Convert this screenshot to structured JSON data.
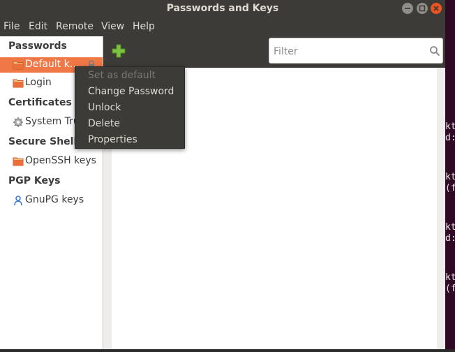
{
  "window": {
    "title": "Passwords and Keys"
  },
  "menubar": [
    "File",
    "Edit",
    "Remote",
    "View",
    "Help"
  ],
  "sidebar": {
    "sections": [
      {
        "title": "Passwords",
        "items": [
          {
            "label": "Default k…",
            "icon": "folder-icon",
            "locked": true,
            "selected": true
          },
          {
            "label": "Login",
            "icon": "folder-icon"
          }
        ]
      },
      {
        "title": "Certificates",
        "items": [
          {
            "label": "System Tru…",
            "icon": "gear-icon"
          }
        ]
      },
      {
        "title": "Secure Shell",
        "items": [
          {
            "label": "OpenSSH keys",
            "icon": "folder-icon"
          }
        ]
      },
      {
        "title": "PGP Keys",
        "items": [
          {
            "label": "GnuPG keys",
            "icon": "person-key-icon"
          }
        ]
      }
    ]
  },
  "toolbar": {
    "add_icon": "plus-icon",
    "filter_placeholder": "Filter"
  },
  "context_menu": {
    "items": [
      {
        "label": "Set as default",
        "enabled": false
      },
      {
        "label": "Change Password",
        "enabled": true
      },
      {
        "label": "Unlock",
        "enabled": true
      },
      {
        "label": "Delete",
        "enabled": true
      },
      {
        "label": "Properties",
        "enabled": true
      }
    ]
  },
  "terminal": {
    "lines": [
      "kt",
      "d:",
      "kt",
      "(f",
      "kt",
      "d:",
      "kt",
      "(f"
    ]
  },
  "colors": {
    "accent": "#f07746",
    "close": "#e95420",
    "chrome": "#3c3b37",
    "terminal_bg": "#300a24"
  }
}
